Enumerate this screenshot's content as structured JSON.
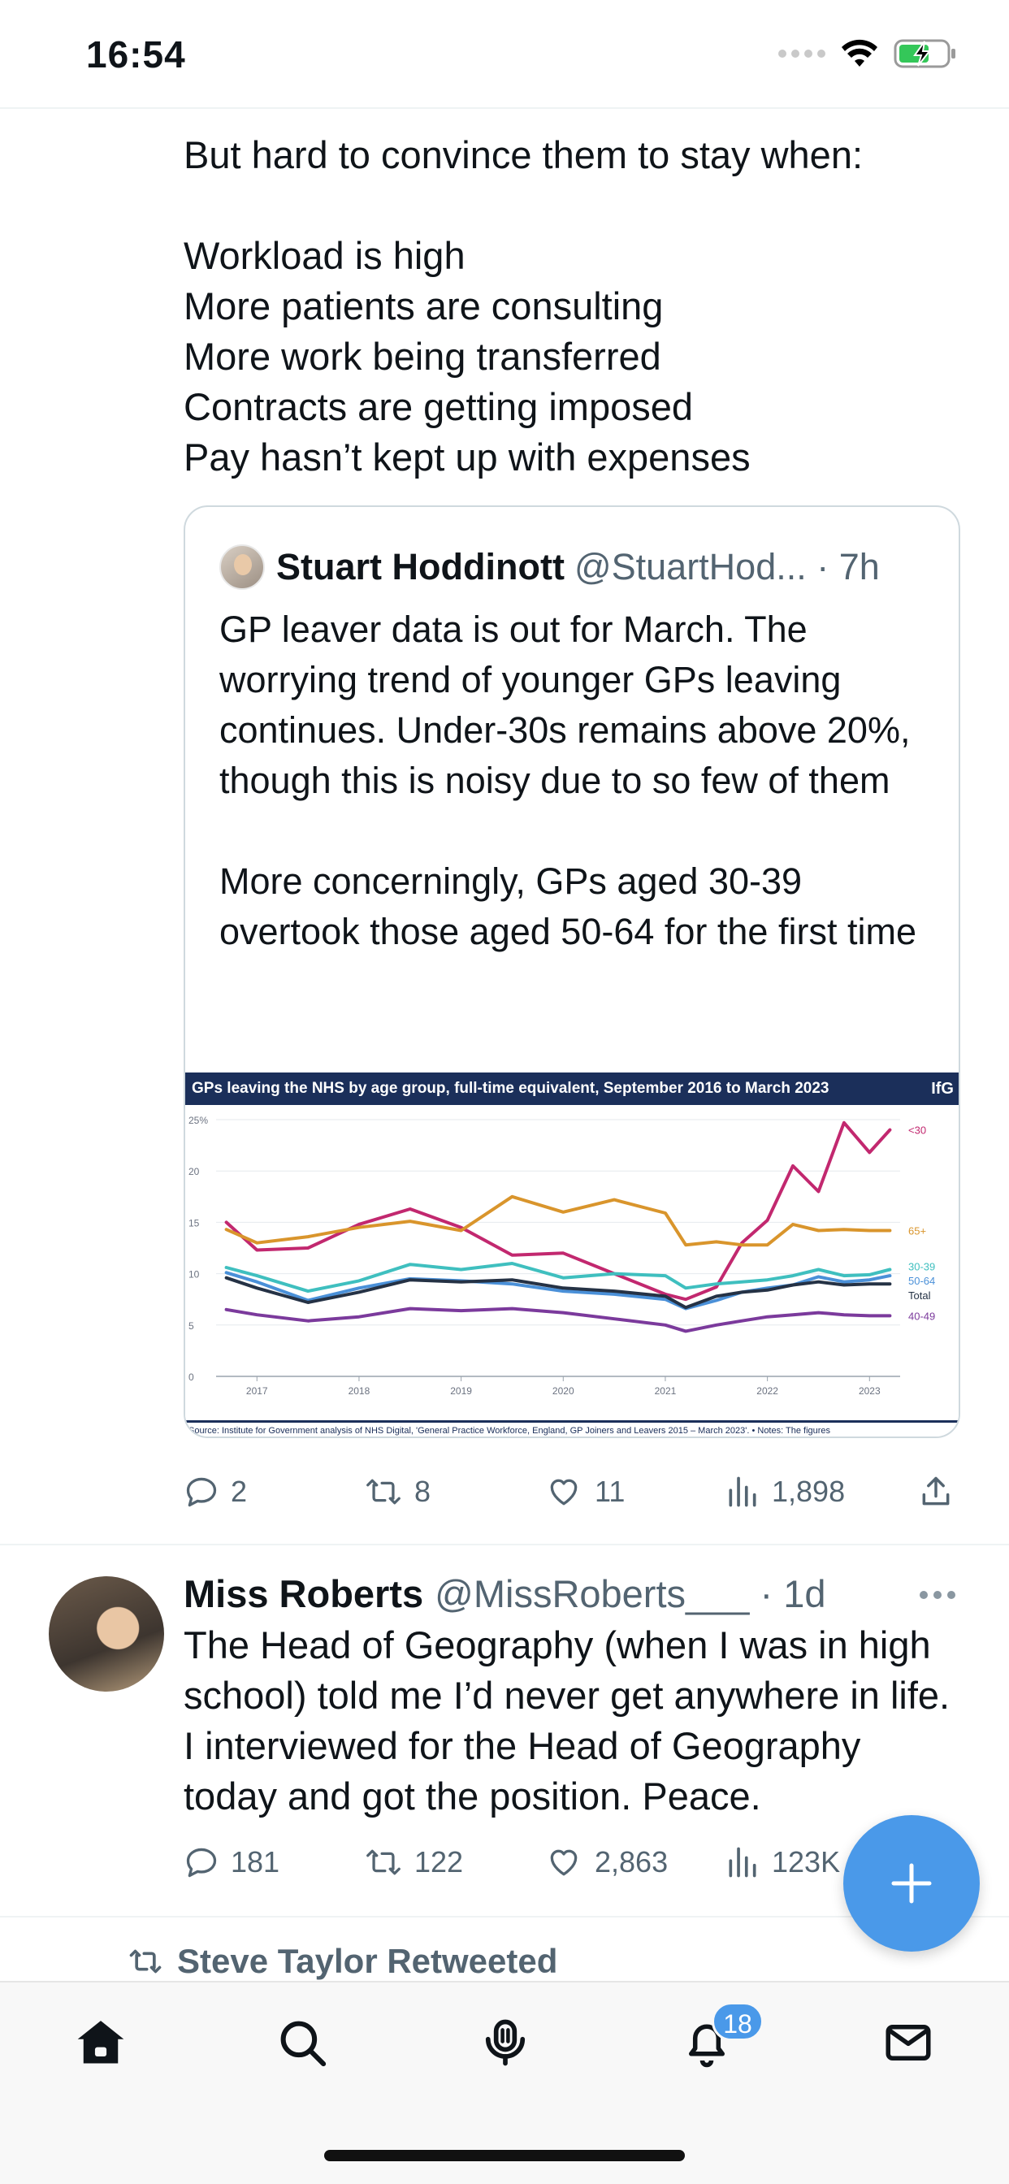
{
  "status_bar": {
    "time": "16:54"
  },
  "tweet1": {
    "text": "But hard to convince them to stay when:\n\nWorkload is high\nMore patients are consulting\nMore work being transferred\nContracts are getting imposed\nPay hasn’t kept up with expenses",
    "quote": {
      "name": "Stuart Hoddinott",
      "handle_time": "@StuartHod... · 7h",
      "text": "GP leaver data is out for March. The worrying trend of younger GPs leaving continues. Under-30s remains above 20%, though this is noisy due to so few of them\n\nMore concerningly, GPs aged 30-39 overtook those aged 50-64 for the first time"
    },
    "stats": {
      "replies": "2",
      "retweets": "8",
      "likes": "11",
      "views": "1,898"
    }
  },
  "chart_data": {
    "type": "line",
    "title": "GPs leaving the NHS by age group, full-time equivalent, September 2016 to March 2023",
    "brand": "IfG",
    "source": "Source: Institute for Government analysis of NHS Digital, 'General Practice Workforce, England, GP Joiners and Leavers 2015 – March 2023'. • Notes: The figures",
    "x": [
      2016.7,
      2017.0,
      2017.5,
      2018.0,
      2018.5,
      2019.0,
      2019.5,
      2020.0,
      2020.5,
      2021.0,
      2021.2,
      2021.5,
      2021.75,
      2022.0,
      2022.25,
      2022.5,
      2022.75,
      2023.0,
      2023.2
    ],
    "x_ticks": [
      "2017",
      "2018",
      "2019",
      "2020",
      "2021",
      "2022",
      "2023"
    ],
    "ylim": [
      0,
      25
    ],
    "y_ticks": [
      "0",
      "5",
      "10",
      "15",
      "20",
      "25%"
    ],
    "series": [
      {
        "name": "<30",
        "color": "#c2286f",
        "values": [
          15.0,
          12.3,
          12.5,
          14.8,
          16.3,
          14.5,
          11.8,
          12.0,
          10.0,
          8.0,
          7.5,
          8.7,
          13.0,
          15.2,
          20.5,
          18.0,
          24.7,
          21.8,
          24.0
        ]
      },
      {
        "name": "65+",
        "color": "#d9952c",
        "values": [
          14.3,
          13.0,
          13.6,
          14.5,
          15.1,
          14.2,
          17.5,
          16.0,
          17.2,
          15.9,
          12.8,
          13.1,
          12.8,
          12.8,
          14.8,
          14.2,
          14.3,
          14.2,
          14.2
        ]
      },
      {
        "name": "30-39",
        "color": "#3fbfbf",
        "values": [
          10.6,
          9.8,
          8.3,
          9.3,
          10.9,
          10.4,
          11.0,
          9.6,
          10.0,
          9.8,
          8.6,
          9.0,
          9.2,
          9.4,
          9.8,
          10.4,
          9.8,
          9.9,
          10.4
        ]
      },
      {
        "name": "50-64",
        "color": "#4a90d8",
        "values": [
          10.1,
          9.2,
          7.4,
          8.6,
          9.5,
          9.3,
          9.0,
          8.3,
          8.0,
          7.5,
          6.6,
          7.4,
          8.2,
          8.6,
          8.9,
          9.7,
          9.2,
          9.4,
          9.8
        ]
      },
      {
        "name": "Total",
        "color": "#253245",
        "values": [
          9.6,
          8.6,
          7.2,
          8.2,
          9.4,
          9.2,
          9.4,
          8.6,
          8.3,
          7.8,
          6.7,
          7.8,
          8.2,
          8.4,
          8.9,
          9.2,
          8.9,
          9.0,
          9.0
        ]
      },
      {
        "name": "40-49",
        "color": "#7b3a9c",
        "values": [
          6.5,
          6.0,
          5.4,
          5.8,
          6.6,
          6.4,
          6.6,
          6.2,
          5.6,
          5.0,
          4.4,
          5.0,
          5.4,
          5.8,
          6.0,
          6.2,
          6.0,
          5.9,
          5.9
        ]
      }
    ]
  },
  "tweet2": {
    "name": "Miss Roberts",
    "handle_time": "@MissRoberts___ · 1d",
    "text": "The Head of Geography (when I was in high school) told me I’d never get anywhere in life. I interviewed for the Head of Geography today and got the position. Peace.",
    "stats": {
      "replies": "181",
      "retweets": "122",
      "likes": "2,863",
      "views": "123K"
    }
  },
  "retweet_label": "Steve Taylor Retweeted",
  "tab_bar": {
    "notifications_badge": "18"
  },
  "colors": {
    "accent": "#4a99e9",
    "muted": "#536471"
  }
}
